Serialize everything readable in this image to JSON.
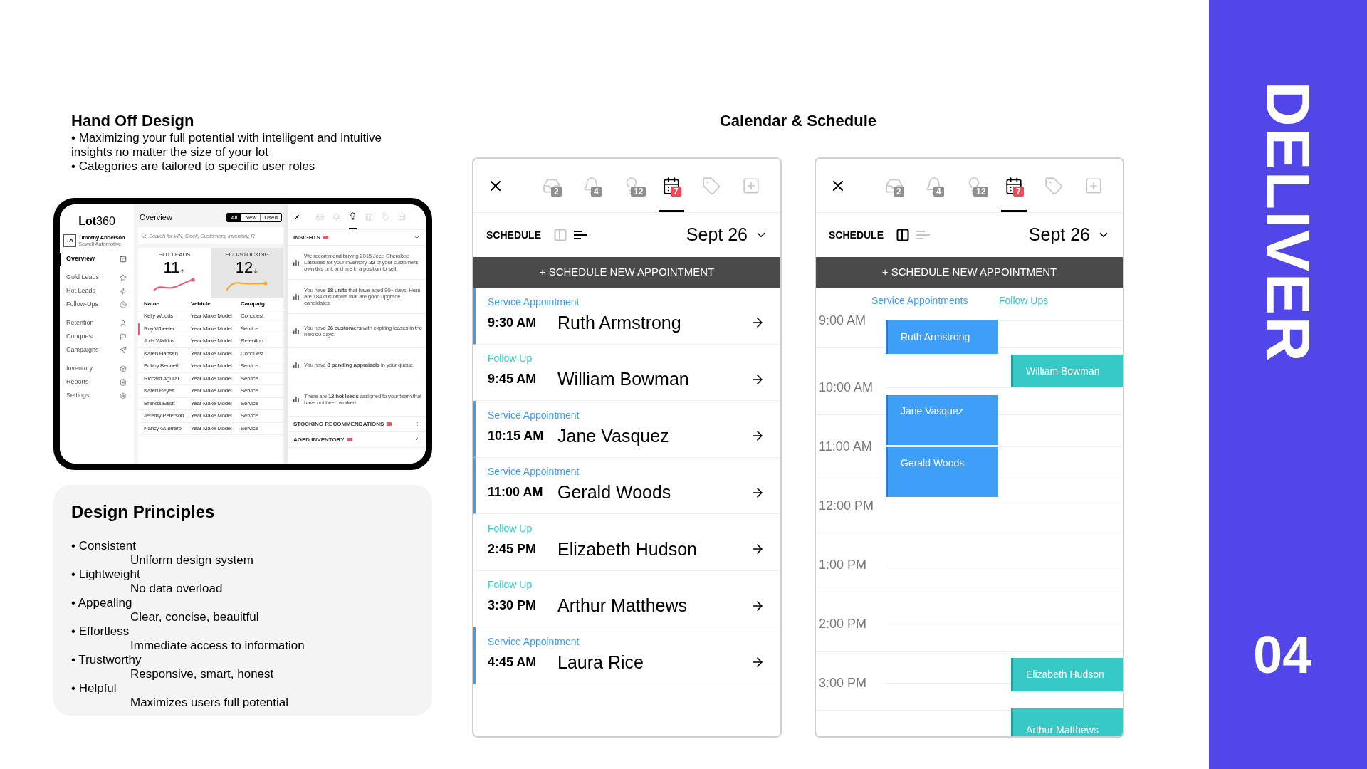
{
  "handoff": {
    "title": "Hand Off Design",
    "bullets": [
      "• Maximizing your full potential with intelligent and intuitive insights no matter the size of your lot",
      "• Categories are tailored to specific user roles"
    ]
  },
  "tablet": {
    "logo": "**Lot**360",
    "user": {
      "initials": "TA",
      "name": "Timothy Anderson",
      "company": "Sewell Automotive"
    },
    "nav": [
      [
        {
          "label": "Overview",
          "selected": true
        }
      ],
      [
        {
          "label": "Gold Leads",
          "selected": false
        },
        {
          "label": "Hot Leads",
          "selected": false
        },
        {
          "label": "Follow-Ups",
          "selected": false
        }
      ],
      [
        {
          "label": "Retention",
          "selected": false
        },
        {
          "label": "Conquest",
          "selected": false
        },
        {
          "label": "Campaigns",
          "selected": false
        }
      ],
      [
        {
          "label": "Inventory",
          "selected": false
        },
        {
          "label": "Reports",
          "selected": false
        },
        {
          "label": "Settings",
          "selected": false
        }
      ]
    ],
    "title": "Overview",
    "filters": [
      {
        "label": "All",
        "selected": true
      },
      {
        "label": "New",
        "selected": false
      },
      {
        "label": "Used",
        "selected": false
      }
    ],
    "search": {
      "placeholder": "Search for VIN, Stock, Customers, Inventory, R"
    },
    "stats": [
      {
        "label": "HOT LEADS",
        "value": "11",
        "kind": "rising",
        "color": "#f0566a",
        "selected": true
      },
      {
        "label": "ECO-STOCKING",
        "value": "12",
        "kind": "falling",
        "color": "#f5a623",
        "selected": false
      }
    ],
    "table": {
      "columns": [
        "Name",
        "Vehicle",
        "Campaig"
      ],
      "rows": [
        {
          "cells": [
            "Kelly Woods",
            "Year Make Model",
            "Conquest"
          ],
          "flagged": false
        },
        {
          "cells": [
            "Roy Wheeler",
            "Year Make Model",
            "Service"
          ],
          "flagged": true
        },
        {
          "cells": [
            "Julia Watkins",
            "Year Make Model",
            "Retention"
          ],
          "flagged": false
        },
        {
          "cells": [
            "Karen Hansen",
            "Year Make Model",
            "Conquest"
          ],
          "flagged": false
        },
        {
          "cells": [
            "Bobby Bennett",
            "Year Make Model",
            "Service"
          ],
          "flagged": false
        },
        {
          "cells": [
            "Richard Aguilar",
            "Year Make Model",
            "Service"
          ],
          "flagged": false
        },
        {
          "cells": [
            "Karen Reyes",
            "Year Make Model",
            "Service"
          ],
          "flagged": false
        },
        {
          "cells": [
            "Brenda Elliott",
            "Year Make Model",
            "Service"
          ],
          "flagged": false
        },
        {
          "cells": [
            "Jeremy Peterson",
            "Year Make Model",
            "Service"
          ],
          "flagged": false
        },
        {
          "cells": [
            "Nancy Guerrero",
            "Year Make Model",
            "Service"
          ],
          "flagged": false
        }
      ]
    },
    "panel": {
      "tabs": [
        {
          "selected": false
        },
        {
          "selected": false
        },
        {
          "selected": true
        },
        {
          "selected": false
        },
        {
          "selected": false
        },
        {
          "selected": false
        }
      ],
      "sections": [
        {
          "title": "INSIGHTS",
          "expanded": true,
          "items": [
            "We recommend buying 2015 Jeep Cherokee Latitudes for your inventory. **22** of your customers own this unit and are in a position to sell.",
            "You have **18 units** that have aged 90+ days. Here are 184 customers that are good upgrade candidates.",
            "You have **26 customers** with expiring leases in the next 60 days.",
            "You have **8 pending appraisals** in your queue.",
            "There are **12 hot leads** assigned to your team that have not been worked."
          ]
        },
        {
          "title": "STOCKING RECOMMENDATIONS",
          "expanded": false
        },
        {
          "title": "AGED INVENTORY",
          "expanded": false
        }
      ]
    }
  },
  "principles": {
    "title": "Design Principles",
    "items": [
      {
        "name": "• Consistent",
        "description": "Uniform design system"
      },
      {
        "name": "• Lightweight",
        "description": "No data overload"
      },
      {
        "name": "• Appealing",
        "description": "Clear, concise, beauitful"
      },
      {
        "name": "• Effortless",
        "description": "Immediate access to information"
      },
      {
        "name": "• Trustworthy",
        "description": "Responsive, smart, honest"
      },
      {
        "name": "• Helpful",
        "description": "Maximizes users full potential"
      }
    ]
  },
  "calendar_title": "Calendar & Schedule",
  "list_panel": {
    "tabs": [
      {
        "badge": "2",
        "selected": false
      },
      {
        "badge": "4",
        "selected": false
      },
      {
        "badge": "12",
        "selected": false
      },
      {
        "badge": "7",
        "selected": true
      },
      {
        "selected": false
      },
      {
        "selected": false
      }
    ],
    "schedule_label": "SCHEDULE",
    "views": [
      {
        "kind": "columns",
        "selected": false
      },
      {
        "kind": "list",
        "selected": true
      }
    ],
    "date": "Sept 26",
    "new_button": "+ SCHEDULE NEW APPOINTMENT",
    "appointments": [
      {
        "type": "Service Appointment",
        "kind": "service",
        "time": "9:30 AM",
        "name": "Ruth Armstrong"
      },
      {
        "type": "Follow Up",
        "kind": "follow_up",
        "time": "9:45 AM",
        "name": "William Bowman"
      },
      {
        "type": "Service Appointment",
        "kind": "service",
        "time": "10:15 AM",
        "name": "Jane Vasquez"
      },
      {
        "type": "Service Appointment",
        "kind": "service",
        "time": "11:00 AM",
        "name": "Gerald Woods"
      },
      {
        "type": "Follow Up",
        "kind": "follow_up",
        "time": "2:45 PM",
        "name": "Elizabeth Hudson"
      },
      {
        "type": "Follow Up",
        "kind": "follow_up",
        "time": "3:30 PM",
        "name": "Arthur Matthews"
      },
      {
        "type": "Service Appointment",
        "kind": "service",
        "time": "4:45 AM",
        "name": "Laura Rice"
      }
    ]
  },
  "calendar_panel": {
    "tabs": [
      {
        "badge": "2",
        "selected": false
      },
      {
        "badge": "4",
        "selected": false
      },
      {
        "badge": "12",
        "selected": false
      },
      {
        "badge": "7",
        "selected": true
      },
      {
        "selected": false
      },
      {
        "selected": false
      }
    ],
    "schedule_label": "SCHEDULE",
    "views": [
      {
        "kind": "columns",
        "selected": true
      },
      {
        "kind": "list",
        "selected": false
      }
    ],
    "date": "Sept 26",
    "new_button": "+ SCHEDULE NEW APPOINTMENT",
    "columns": [
      {
        "label": "Service Appointments",
        "kind": "service"
      },
      {
        "label": "Follow Ups",
        "kind": "follow_up"
      }
    ],
    "hours": [
      "9:00 AM",
      "10:00 AM",
      "11:00 AM",
      "12:00 PM",
      "1:00 PM",
      "2:00 PM",
      "3:00 PM"
    ],
    "events": [
      {
        "name": "Ruth Armstrong",
        "kind": "service"
      },
      {
        "name": "William Bowman",
        "kind": "follow_up"
      },
      {
        "name": "Jane Vasquez",
        "kind": "service"
      },
      {
        "name": "Gerald Woods",
        "kind": "service"
      },
      {
        "name": "Elizabeth Hudson",
        "kind": "follow_up"
      },
      {
        "name": "Arthur Matthews",
        "kind": "follow_up"
      }
    ]
  },
  "side": {
    "word": "DELIVER",
    "number": "04"
  }
}
